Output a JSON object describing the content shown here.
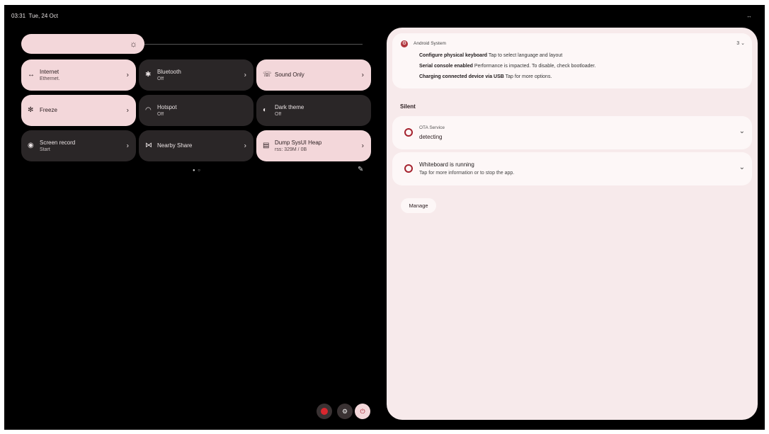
{
  "status_bar": {
    "time": "03:31",
    "date": "Tue, 24 Oct",
    "right_icon": "↔"
  },
  "brightness": {
    "level": 0.36,
    "icon": "☼"
  },
  "tiles": [
    {
      "label": "Internet",
      "sub": "Ethernet.",
      "icon": "↔",
      "state": "on"
    },
    {
      "label": "Bluetooth",
      "sub": "Off",
      "icon": "✱",
      "state": "off"
    },
    {
      "label": "Sound Only",
      "sub": "",
      "icon": "☏",
      "state": "on"
    },
    {
      "label": "Freeze",
      "sub": "",
      "icon": "✻",
      "state": "on"
    },
    {
      "label": "Hotspot",
      "sub": "Off",
      "icon": "◠",
      "state": "off"
    },
    {
      "label": "Dark theme",
      "sub": "Off",
      "icon": "◐",
      "state": "off"
    },
    {
      "label": "Screen record",
      "sub": "Start",
      "icon": "◉",
      "state": "off"
    },
    {
      "label": "Nearby Share",
      "sub": "",
      "icon": "⋈",
      "state": "off"
    },
    {
      "label": "Dump SysUI Heap",
      "sub": "rss: 329M / 0B",
      "icon": "▤",
      "state": "on"
    }
  ],
  "page_dots": "● ○",
  "edit_icon": "✎",
  "power_row": {
    "settings_icon": "⚙",
    "power_icon": "⏻"
  },
  "notifications": {
    "android_system": {
      "app_name": "Android System",
      "count": "3",
      "lines": [
        {
          "title": "Configure physical keyboard",
          "text": "Tap to select language and layout"
        },
        {
          "title": "Serial console enabled",
          "text": "Performance is impacted. To disable, check bootloader."
        },
        {
          "title": "Charging connected device via USB",
          "text": "Tap for more options."
        }
      ]
    },
    "silent_header": "Silent",
    "ota": {
      "title": "OTA Service",
      "text": "detecting"
    },
    "whiteboard": {
      "title": "Whiteboard is running",
      "text": "Tap for more information or to stop the app."
    },
    "manage_label": "Manage"
  }
}
